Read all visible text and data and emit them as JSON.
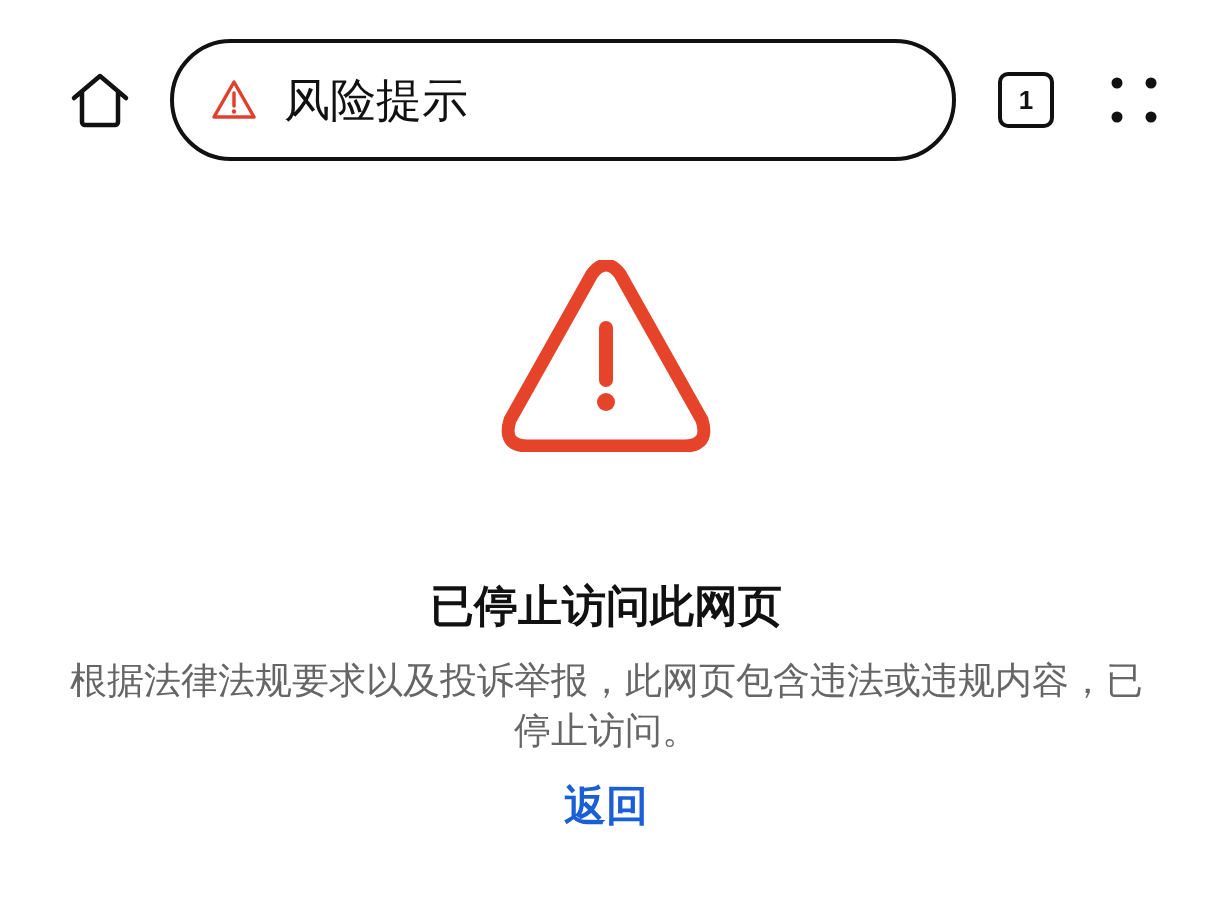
{
  "toolbar": {
    "page_title": "风险提示",
    "tab_count": "1"
  },
  "error": {
    "title": "已停止访问此网页",
    "message": "根据法律法规要求以及投诉举报，此网页包含违法或违规内容，已停止访问。",
    "link": "返回"
  }
}
